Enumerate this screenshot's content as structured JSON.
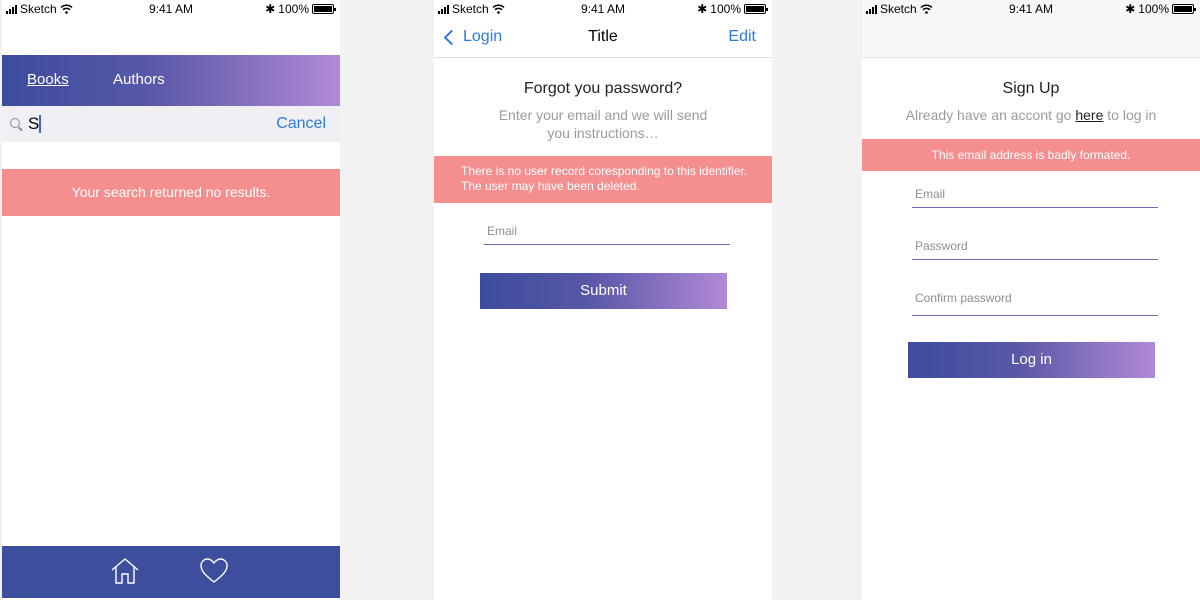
{
  "statusbar": {
    "carrier": "Sketch",
    "time": "9:41 AM",
    "battery": "100%"
  },
  "search_screen": {
    "tabs": [
      {
        "label": "Books"
      },
      {
        "label": "Authors"
      }
    ],
    "search_value": "S",
    "cancel_label": "Cancel",
    "alert": "Your search returned no results.",
    "bottom_nav": {
      "home_icon": "home-icon",
      "favorites_icon": "heart-icon"
    }
  },
  "forgot_screen": {
    "nav": {
      "back_label": "Login",
      "title": "Title",
      "edit_label": "Edit"
    },
    "heading": "Forgot you password?",
    "subtext_line1": "Enter your email and we will send",
    "subtext_line2": "you instructions…",
    "alert_line1": "There is no user record coresponding to this identifier.",
    "alert_line2": "The user may have been deleted.",
    "email_placeholder": "Email",
    "submit_label": "Submit"
  },
  "signup_screen": {
    "heading": "Sign Up",
    "subtext_before": "Already have an accont go ",
    "subtext_link": "here",
    "subtext_after": " to log in",
    "alert": "This email address is badly formated.",
    "email_placeholder": "Email",
    "password_placeholder": "Password",
    "confirm_placeholder": "Confirm password",
    "login_label": "Log in"
  },
  "colors": {
    "accent_start": "#3c4c9c",
    "accent_end": "#b18ad6",
    "alert": "#f58f8f",
    "link": "#2a7ae2"
  }
}
